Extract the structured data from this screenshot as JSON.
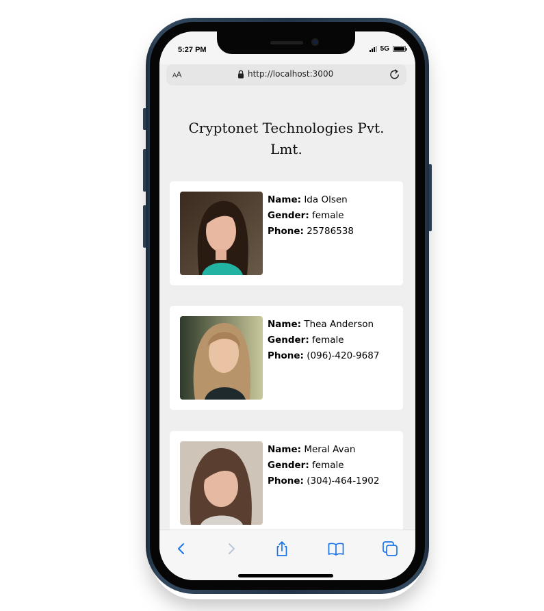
{
  "status_bar": {
    "time": "5:27 PM",
    "network": "5G"
  },
  "browser": {
    "text_size_button": {
      "small": "A",
      "large": "A"
    },
    "url": "http://localhost:3000",
    "icons": {
      "lock": "lock-icon",
      "reload": "reload-icon"
    }
  },
  "page": {
    "title": "Cryptonet Technologies Pvt. Lmt.",
    "labels": {
      "name": "Name:",
      "gender": "Gender:",
      "phone": "Phone:"
    },
    "users": [
      {
        "name": "Ida Olsen",
        "gender": "female",
        "phone": "25786538"
      },
      {
        "name": "Thea Anderson",
        "gender": "female",
        "phone": "(096)-420-9687"
      },
      {
        "name": "Meral Avan",
        "gender": "female",
        "phone": "(304)-464-1902"
      }
    ]
  },
  "toolbar": {
    "icons": [
      "back-icon",
      "forward-icon",
      "share-icon",
      "bookmarks-icon",
      "tabs-icon"
    ],
    "accent_color": "#1a73e8",
    "disabled_color": "#b8c6d8"
  }
}
